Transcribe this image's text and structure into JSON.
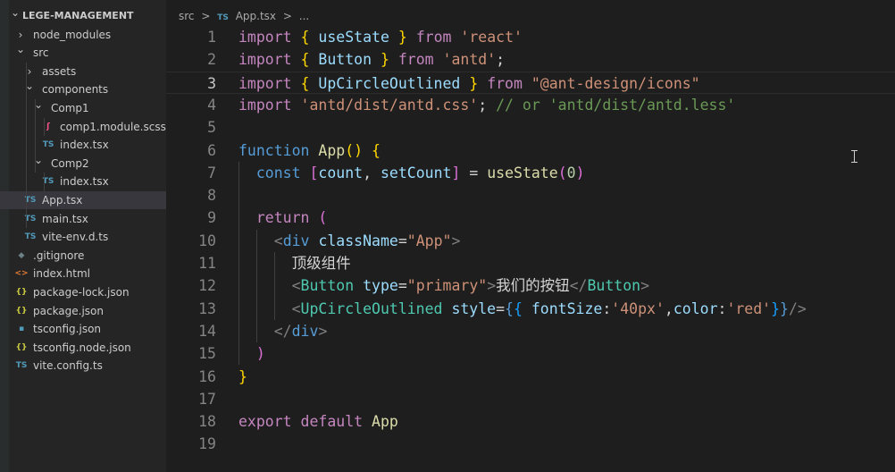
{
  "explorer": {
    "root": "LEGE-MANAGEMENT",
    "items": [
      {
        "name": "node_modules",
        "kind": "folder",
        "expanded": false,
        "depth": 1,
        "icon": "chevron-right-icon"
      },
      {
        "name": "src",
        "kind": "folder",
        "expanded": true,
        "depth": 1,
        "icon": "chevron-down-icon"
      },
      {
        "name": "assets",
        "kind": "folder",
        "expanded": false,
        "depth": 2,
        "icon": "chevron-right-icon"
      },
      {
        "name": "components",
        "kind": "folder",
        "expanded": true,
        "depth": 2,
        "icon": "chevron-down-icon"
      },
      {
        "name": "Comp1",
        "kind": "folder",
        "expanded": true,
        "depth": 3,
        "icon": "chevron-down-icon"
      },
      {
        "name": "comp1.module.scss",
        "kind": "file",
        "depth": 4,
        "badge": "ʃ",
        "badge_color": "#f55385",
        "icon": "scss-file-icon"
      },
      {
        "name": "index.tsx",
        "kind": "file",
        "depth": 4,
        "badge": "TS",
        "badge_color": "#519aba",
        "icon": "typescript-file-icon"
      },
      {
        "name": "Comp2",
        "kind": "folder",
        "expanded": true,
        "depth": 3,
        "icon": "chevron-down-icon"
      },
      {
        "name": "index.tsx",
        "kind": "file",
        "depth": 4,
        "badge": "TS",
        "badge_color": "#519aba",
        "icon": "typescript-file-icon"
      },
      {
        "name": "App.tsx",
        "kind": "file",
        "depth": 2,
        "badge": "TS",
        "badge_color": "#519aba",
        "selected": true,
        "icon": "typescript-file-icon"
      },
      {
        "name": "main.tsx",
        "kind": "file",
        "depth": 2,
        "badge": "TS",
        "badge_color": "#519aba",
        "icon": "typescript-file-icon"
      },
      {
        "name": "vite-env.d.ts",
        "kind": "file",
        "depth": 2,
        "badge": "TS",
        "badge_color": "#519aba",
        "icon": "typescript-file-icon"
      },
      {
        "name": ".gitignore",
        "kind": "file",
        "depth": 1,
        "badge": "◆",
        "badge_color": "#6d8086",
        "icon": "gitignore-file-icon"
      },
      {
        "name": "index.html",
        "kind": "file",
        "depth": 1,
        "badge": "<>",
        "badge_color": "#e37933",
        "icon": "html-file-icon"
      },
      {
        "name": "package-lock.json",
        "kind": "file",
        "depth": 1,
        "badge": "{}",
        "badge_color": "#cbcb41",
        "icon": "json-file-icon"
      },
      {
        "name": "package.json",
        "kind": "file",
        "depth": 1,
        "badge": "{}",
        "badge_color": "#cbcb41",
        "icon": "json-file-icon"
      },
      {
        "name": "tsconfig.json",
        "kind": "file",
        "depth": 1,
        "badge": "▪",
        "badge_color": "#519aba",
        "icon": "tsconfig-file-icon"
      },
      {
        "name": "tsconfig.node.json",
        "kind": "file",
        "depth": 1,
        "badge": "{}",
        "badge_color": "#cbcb41",
        "icon": "json-file-icon"
      },
      {
        "name": "vite.config.ts",
        "kind": "file",
        "depth": 1,
        "badge": "TS",
        "badge_color": "#519aba",
        "icon": "typescript-file-icon"
      }
    ]
  },
  "breadcrumb": {
    "folder": "src",
    "separator": ">",
    "file_badge": "TS",
    "file": "App.tsx",
    "trailing": "..."
  },
  "editor": {
    "active_line": 3,
    "lines": [
      {
        "n": "1",
        "tokens": [
          [
            "import",
            "k"
          ],
          [
            " ",
            "p"
          ],
          [
            "{",
            "b1"
          ],
          [
            " ",
            "p"
          ],
          [
            "useState",
            "v"
          ],
          [
            " ",
            "p"
          ],
          [
            "}",
            "b1"
          ],
          [
            " ",
            "p"
          ],
          [
            "from",
            "k"
          ],
          [
            " ",
            "p"
          ],
          [
            "'react'",
            "s"
          ]
        ]
      },
      {
        "n": "2",
        "tokens": [
          [
            "import",
            "k"
          ],
          [
            " ",
            "p"
          ],
          [
            "{",
            "b1"
          ],
          [
            " ",
            "p"
          ],
          [
            "Button",
            "v"
          ],
          [
            " ",
            "p"
          ],
          [
            "}",
            "b1"
          ],
          [
            " ",
            "p"
          ],
          [
            "from",
            "k"
          ],
          [
            " ",
            "p"
          ],
          [
            "'antd'",
            "s"
          ],
          [
            ";",
            "p"
          ]
        ]
      },
      {
        "n": "3",
        "tokens": [
          [
            "import",
            "k"
          ],
          [
            " ",
            "p"
          ],
          [
            "{",
            "b1"
          ],
          [
            " ",
            "p"
          ],
          [
            "UpCircleOutlined",
            "v"
          ],
          [
            " ",
            "p"
          ],
          [
            "}",
            "b1"
          ],
          [
            " ",
            "p"
          ],
          [
            "from",
            "k"
          ],
          [
            " ",
            "p"
          ],
          [
            "\"@ant-design/icons\"",
            "s"
          ]
        ]
      },
      {
        "n": "4",
        "tokens": [
          [
            "import",
            "k"
          ],
          [
            " ",
            "p"
          ],
          [
            "'antd/dist/antd.css'",
            "s"
          ],
          [
            ";",
            "p"
          ],
          [
            " ",
            "p"
          ],
          [
            "// or 'antd/dist/antd.less'",
            "cm"
          ]
        ]
      },
      {
        "n": "5",
        "tokens": []
      },
      {
        "n": "6",
        "tokens": [
          [
            "function",
            "d"
          ],
          [
            " ",
            "p"
          ],
          [
            "App",
            "f"
          ],
          [
            "()",
            "b1"
          ],
          [
            " ",
            "p"
          ],
          [
            "{",
            "b1"
          ]
        ]
      },
      {
        "n": "7",
        "tokens": [
          [
            "  ",
            "p"
          ],
          [
            "const",
            "d"
          ],
          [
            " ",
            "p"
          ],
          [
            "[",
            "b2"
          ],
          [
            "count",
            "v"
          ],
          [
            ", ",
            "p"
          ],
          [
            "setCount",
            "v"
          ],
          [
            "]",
            "b2"
          ],
          [
            " = ",
            "p"
          ],
          [
            "useState",
            "f"
          ],
          [
            "(",
            "b2"
          ],
          [
            "0",
            "n"
          ],
          [
            ")",
            "b2"
          ]
        ]
      },
      {
        "n": "8",
        "tokens": []
      },
      {
        "n": "9",
        "tokens": [
          [
            "  ",
            "p"
          ],
          [
            "return",
            "k"
          ],
          [
            " ",
            "p"
          ],
          [
            "(",
            "b2"
          ]
        ]
      },
      {
        "n": "10",
        "tokens": [
          [
            "    ",
            "p"
          ],
          [
            "<",
            "g"
          ],
          [
            "div",
            "t"
          ],
          [
            " ",
            "p"
          ],
          [
            "className",
            "a"
          ],
          [
            "=",
            "p"
          ],
          [
            "\"App\"",
            "s"
          ],
          [
            ">",
            "g"
          ]
        ]
      },
      {
        "n": "11",
        "tokens": [
          [
            "      ",
            "p"
          ],
          [
            "顶级组件",
            "p"
          ]
        ]
      },
      {
        "n": "12",
        "tokens": [
          [
            "      ",
            "p"
          ],
          [
            "<",
            "g"
          ],
          [
            "Button",
            "c"
          ],
          [
            " ",
            "p"
          ],
          [
            "type",
            "a"
          ],
          [
            "=",
            "p"
          ],
          [
            "\"primary\"",
            "s"
          ],
          [
            ">",
            "g"
          ],
          [
            "我们的按钮",
            "p"
          ],
          [
            "</",
            "g"
          ],
          [
            "Button",
            "c"
          ],
          [
            ">",
            "g"
          ]
        ]
      },
      {
        "n": "13",
        "tokens": [
          [
            "      ",
            "p"
          ],
          [
            "<",
            "g"
          ],
          [
            "UpCircleOutlined",
            "c"
          ],
          [
            " ",
            "p"
          ],
          [
            "style",
            "a"
          ],
          [
            "=",
            "p"
          ],
          [
            "{",
            "d"
          ],
          [
            "{",
            "b3"
          ],
          [
            " ",
            "p"
          ],
          [
            "fontSize",
            "a"
          ],
          [
            ":",
            "p"
          ],
          [
            "'40px'",
            "s"
          ],
          [
            ",",
            "p"
          ],
          [
            "color",
            "a"
          ],
          [
            ":",
            "p"
          ],
          [
            "'red'",
            "s"
          ],
          [
            "}",
            "b3"
          ],
          [
            "}",
            "d"
          ],
          [
            "/>",
            "g"
          ]
        ]
      },
      {
        "n": "14",
        "tokens": [
          [
            "    ",
            "p"
          ],
          [
            "</",
            "g"
          ],
          [
            "div",
            "t"
          ],
          [
            ">",
            "g"
          ]
        ]
      },
      {
        "n": "15",
        "tokens": [
          [
            "  ",
            "p"
          ],
          [
            ")",
            "b2"
          ]
        ]
      },
      {
        "n": "16",
        "tokens": [
          [
            "}",
            "b1"
          ]
        ]
      },
      {
        "n": "17",
        "tokens": []
      },
      {
        "n": "18",
        "tokens": [
          [
            "export",
            "k"
          ],
          [
            " ",
            "p"
          ],
          [
            "default",
            "k"
          ],
          [
            " ",
            "p"
          ],
          [
            "App",
            "f"
          ]
        ]
      },
      {
        "n": "19",
        "tokens": []
      }
    ]
  }
}
